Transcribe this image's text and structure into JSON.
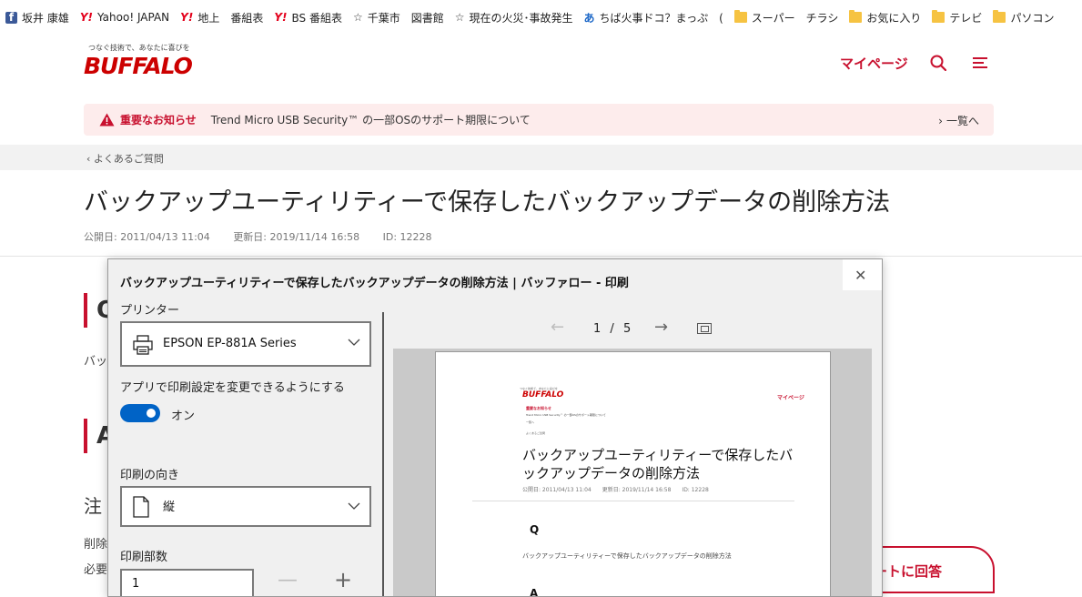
{
  "bookmarks": [
    {
      "icon": "facebook-icon",
      "label": "坂井 康雄"
    },
    {
      "icon": "yahoo-icon",
      "label": "Yahoo! JAPAN"
    },
    {
      "icon": "yahoo-icon",
      "label": "地上　番組表"
    },
    {
      "icon": "yahoo-icon",
      "label": "BS  番組表"
    },
    {
      "icon": "star-icon",
      "label": "千葉市　図書館"
    },
    {
      "icon": "star-icon",
      "label": "現在の火災･事故発生"
    },
    {
      "icon": "hiragana-a-icon",
      "label": "ちば火事ドコ？まっぷ　("
    },
    {
      "icon": "folder-icon",
      "label": "スーパー　チラシ"
    },
    {
      "icon": "folder-icon",
      "label": "お気に入り"
    },
    {
      "icon": "folder-icon",
      "label": "テレビ"
    },
    {
      "icon": "folder-icon",
      "label": "パソコン"
    }
  ],
  "header": {
    "logo_tagline": "つなぐ技術で、あなたに喜びを",
    "logo": "BUFFALO",
    "mypage": "マイページ"
  },
  "notice": {
    "title": "重要なお知らせ",
    "text": "Trend Micro USB Security™ の一部OSのサポート期限について",
    "list_link": "一覧へ"
  },
  "breadcrumb": "よくあるご質問",
  "article": {
    "title": "バックアップユーティリティーで保存したバックアップデータの削除方法",
    "published": "公開日: 2011/04/13 11:04",
    "updated": "更新日: 2019/11/14 16:58",
    "id": "ID: 12228",
    "q_label": "Q",
    "q_text": "バッ",
    "a_label": "A",
    "note": "注",
    "line1": "削除",
    "line2": "必要"
  },
  "survey_button": "ートに回答",
  "print_dialog": {
    "title": "バックアップユーティリティーで保存したバックアップデータの削除方法 | バッファロー - 印刷",
    "printer_label": "プリンター",
    "printer_value": "EPSON EP-881A Series",
    "app_settings_label": "アプリで印刷設定を変更できるようにする",
    "toggle_state": "オン",
    "orientation_label": "印刷の向き",
    "orientation_value": "縦",
    "copies_label": "印刷部数",
    "copies_value": "1",
    "page_current": "1",
    "page_total": "5",
    "page_sep": "/"
  },
  "preview": {
    "logo_tagline": "つなぐ技術で、あなたに喜びを",
    "logo": "BUFFALO",
    "mypage": "マイページ",
    "notice_title": "重要なお知らせ",
    "notice_text": "Trend Micro USB Security™ の一部OSのサポート期限について",
    "list_link": "一覧へ",
    "crumb": "よくあるご質問",
    "title": "バックアップユーティリティーで保存したバックアップデータの削除方法",
    "meta": "公開日: 2011/04/13 11:04　　更新日: 2019/11/14 16:58　　ID: 12228",
    "q_label": "Q",
    "q_text": "バックアップユーティリティーで保存したバックアップデータの削除方法",
    "a_label": "A"
  }
}
